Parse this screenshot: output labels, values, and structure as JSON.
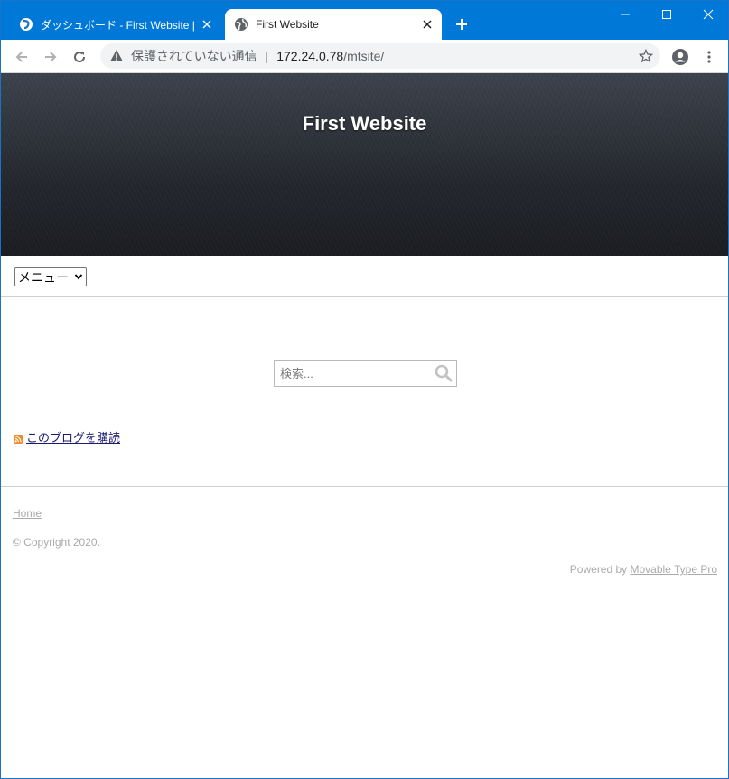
{
  "browser": {
    "tabs": [
      {
        "title": "ダッシュボード - First Website | Mov",
        "active": false,
        "icon": "movable-type-icon"
      },
      {
        "title": "First Website",
        "active": true,
        "icon": "globe-icon"
      }
    ],
    "omnibox": {
      "security_text": "保護されていない通信",
      "separator": "|",
      "host": "172.24.0.78",
      "path": "/mtsite/"
    }
  },
  "page": {
    "site_title": "First Website",
    "menu_select": {
      "selected": "メニュー"
    },
    "search": {
      "placeholder": "検索..."
    },
    "subscribe_link": "このブログを購読",
    "footer": {
      "home_link": "Home",
      "copyright": "© Copyright 2020.",
      "powered_prefix": "Powered by ",
      "powered_link": "Movable Type Pro"
    }
  },
  "colors": {
    "tabstrip": "#0078d7",
    "hero_dark": "#24272d",
    "link": "#1a1a6e",
    "footer_text": "#aaaaaa"
  }
}
